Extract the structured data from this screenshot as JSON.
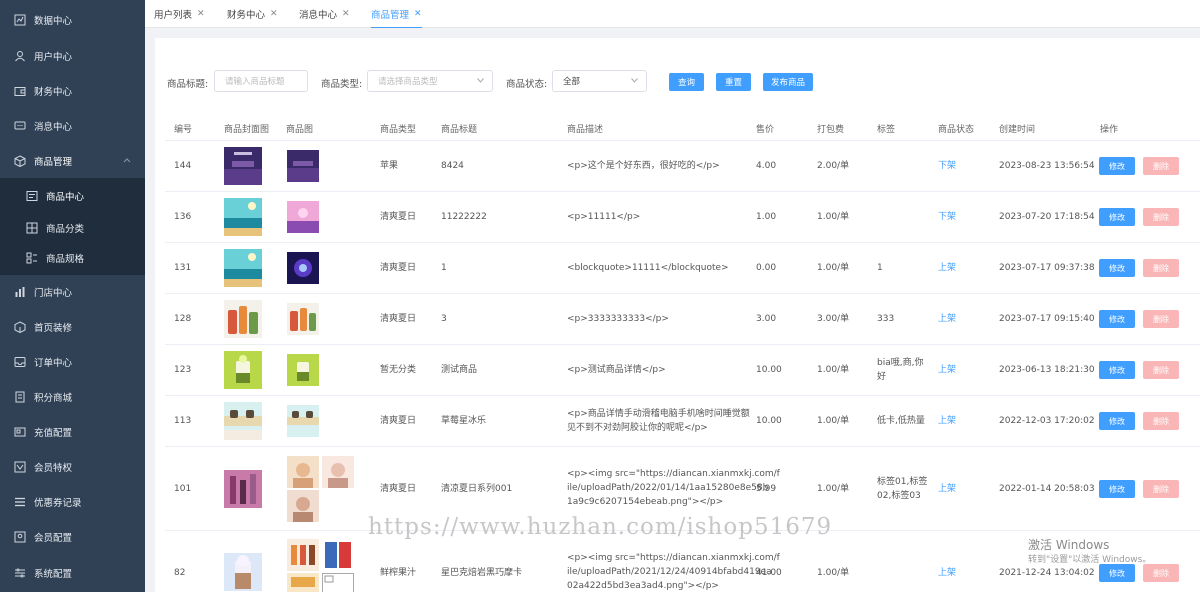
{
  "sidebar": {
    "items": [
      {
        "label": "数据中心",
        "icon": "chart-icon"
      },
      {
        "label": "用户中心",
        "icon": "user-icon"
      },
      {
        "label": "财务中心",
        "icon": "wallet-icon"
      },
      {
        "label": "消息中心",
        "icon": "message-icon"
      },
      {
        "label": "商品管理",
        "icon": "box-icon"
      },
      {
        "label": "商品中心",
        "icon": "list-icon"
      },
      {
        "label": "商品分类",
        "icon": "grid-icon"
      },
      {
        "label": "商品规格",
        "icon": "spec-icon"
      },
      {
        "label": "门店中心",
        "icon": "bar-icon"
      },
      {
        "label": "首页装修",
        "icon": "cube-icon"
      },
      {
        "label": "订单中心",
        "icon": "inbox-icon"
      },
      {
        "label": "积分商城",
        "icon": "doc-icon"
      },
      {
        "label": "充值配置",
        "icon": "card-icon"
      },
      {
        "label": "会员特权",
        "icon": "vip-icon"
      },
      {
        "label": "优惠券记录",
        "icon": "coupon-icon"
      },
      {
        "label": "会员配置",
        "icon": "member-icon"
      },
      {
        "label": "系统配置",
        "icon": "settings-icon"
      }
    ]
  },
  "tabs": [
    {
      "label": "用户列表"
    },
    {
      "label": "财务中心"
    },
    {
      "label": "消息中心"
    },
    {
      "label": "商品管理"
    }
  ],
  "filters": {
    "title_label": "商品标题:",
    "title_placeholder": "请输入商品标题",
    "type_label": "商品类型:",
    "type_placeholder": "请选择商品类型",
    "status_label": "商品状态:",
    "status_value": "全部",
    "search_button": "查询",
    "reset_button": "重置",
    "publish_button": "发布商品"
  },
  "table": {
    "headers": [
      "编号",
      "商品封面图",
      "商品图",
      "商品类型",
      "商品标题",
      "商品描述",
      "售价",
      "打包费",
      "标签",
      "商品状态",
      "创建时间",
      "操作"
    ],
    "edit_label": "修改",
    "delete_label": "删除",
    "rows": [
      {
        "id": "144",
        "type": "苹果",
        "title": "8424",
        "desc": [
          "<p>这个是个好东西，很好吃的</p>"
        ],
        "price": "4.00",
        "fee": "2.00/单",
        "tags": [
          ""
        ],
        "status": "下架",
        "time": "2023-08-23 13:56:54"
      },
      {
        "id": "136",
        "type": "清爽夏日",
        "title": "11222222",
        "desc": [
          "<p>11111</p>"
        ],
        "price": "1.00",
        "fee": "1.00/单",
        "tags": [
          ""
        ],
        "status": "下架",
        "time": "2023-07-20 17:18:54"
      },
      {
        "id": "131",
        "type": "清爽夏日",
        "title": "1",
        "desc": [
          "<blockquote>11111</blockquote>"
        ],
        "price": "0.00",
        "fee": "1.00/单",
        "tags": [
          "1"
        ],
        "status": "上架",
        "time": "2023-07-17 09:37:38"
      },
      {
        "id": "128",
        "type": "清爽夏日",
        "title": "3",
        "desc": [
          "<p>3333333333</p>"
        ],
        "price": "3.00",
        "fee": "3.00/单",
        "tags": [
          "333"
        ],
        "status": "上架",
        "time": "2023-07-17 09:15:40"
      },
      {
        "id": "123",
        "type": "暂无分类",
        "title": "测试商品",
        "desc": [
          "<p>测试商品详情</p>"
        ],
        "price": "10.00",
        "fee": "1.00/单",
        "tags": [
          "bia哦,商,你",
          "好"
        ],
        "status": "上架",
        "time": "2023-06-13 18:21:30"
      },
      {
        "id": "113",
        "type": "清爽夏日",
        "title": "草莓星冰乐",
        "desc": [
          "<p>商品详情手动滑稽电脑手机啥时间睡觉额",
          "见不到不对劲阿胶让你的呢呢</p>"
        ],
        "price": "10.00",
        "fee": "1.00/单",
        "tags": [
          "低卡,低热量"
        ],
        "status": "上架",
        "time": "2022-12-03 17:20:02"
      },
      {
        "id": "101",
        "type": "清爽夏日",
        "title": "清凉夏日系列001",
        "desc": [
          "<p><img src=\"https://diancan.xianmxkj.com/f",
          "ile/uploadPath/2022/01/14/1aa15280e8e58b",
          "1a9c9c6207154ebeab.png\"></p>"
        ],
        "price": "5.99",
        "fee": "1.00/单",
        "tags": [
          "标签01,标签",
          "02,标签03"
        ],
        "status": "上架",
        "time": "2022-01-14 20:58:03"
      },
      {
        "id": "82",
        "type": "鲜榨果汁",
        "title": "星巴克焙岩黑巧摩卡",
        "desc": [
          "<p><img src=\"https://diancan.xianmxkj.com/f",
          "ile/uploadPath/2021/12/24/40914bfabd419ea",
          "02a422d5bd3ea3ad4.png\"></p>"
        ],
        "price": "41.00",
        "fee": "1.00/单",
        "tags": [
          ""
        ],
        "status": "上架",
        "time": "2021-12-24 13:04:02"
      }
    ]
  },
  "overlay": {
    "watermark": "https://www.huzhan.com/ishop51679",
    "activate_title": "激活 Windows",
    "activate_sub": "转到\"设置\"以激活 Windows。"
  },
  "colors": {
    "sidebar": "#304156",
    "submenu": "#1f2d3d",
    "primary": "#409eff",
    "danger_light": "#fab6b6"
  }
}
